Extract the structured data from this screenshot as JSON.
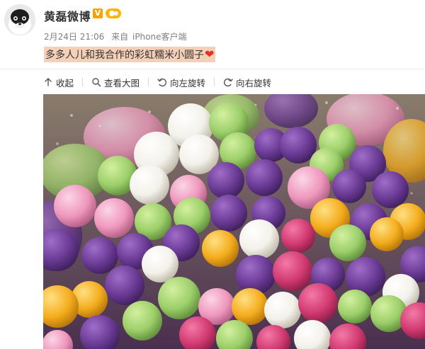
{
  "post": {
    "username": "黄磊微博",
    "verified_badge": "V",
    "date": "2月24日 21:06",
    "source_prefix": "来自",
    "source": "iPhone客户端",
    "text": "多多人儿和我合作的彩虹糯米小圆子",
    "emoji": "heart"
  },
  "toolbar": {
    "items": [
      {
        "label": "收起",
        "icon": "arrow-up-icon"
      },
      {
        "label": "查看大图",
        "icon": "magnifier-icon"
      },
      {
        "label": "向左旋转",
        "icon": "rotate-left-icon"
      },
      {
        "label": "向右旋转",
        "icon": "rotate-right-icon"
      }
    ]
  },
  "colors": {
    "text": "#333333",
    "meta": "#808080",
    "highlight": "#f5d0b9",
    "heart": "#e3302a",
    "verified": "#f6a200"
  }
}
